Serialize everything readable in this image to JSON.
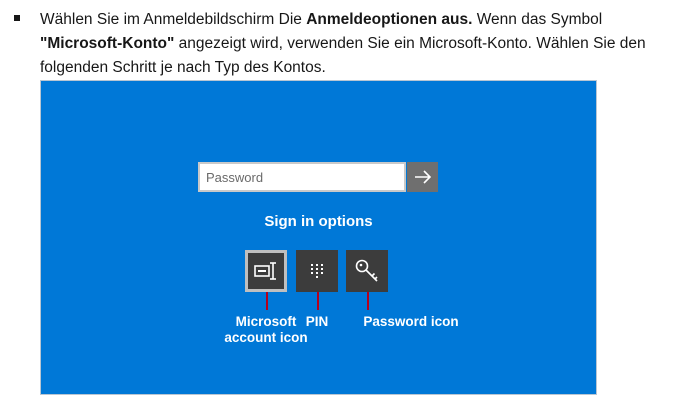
{
  "instruction": {
    "part1": "Wählen Sie im Anmeldebildschirm Die ",
    "bold1": "Anmeldeoptionen aus.",
    "part2": " Wenn das Symbol ",
    "bold2": "\"Microsoft-Konto\"",
    "part3": " angezeigt wird, verwenden Sie ein Microsoft-Konto. Wählen Sie den folgenden Schritt je nach Typ des Kontos."
  },
  "login": {
    "password_placeholder": "Password",
    "submit_icon": "arrow-right-icon",
    "sign_in_options": "Sign in options",
    "options": [
      {
        "icon": "microsoft-account-icon",
        "selected": true
      },
      {
        "icon": "pin-keypad-icon",
        "selected": false
      },
      {
        "icon": "key-icon",
        "selected": false
      }
    ],
    "captions": {
      "microsoft_line1": "Microsoft",
      "microsoft_line2": "account icon",
      "pin": "PIN",
      "password": "Password icon"
    },
    "colors": {
      "background": "#0078d7",
      "tile": "#3c3c3c",
      "pointer": "#b5001d"
    }
  }
}
